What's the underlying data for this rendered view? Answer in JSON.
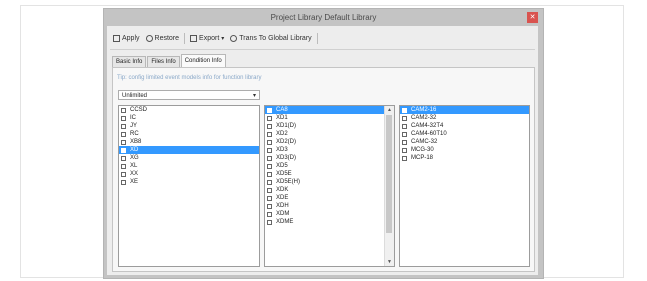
{
  "window": {
    "title": "Project Library Default Library",
    "close_glyph": "✕"
  },
  "toolbar": {
    "apply_label": "Apply",
    "restore_label": "Restore",
    "export_label": "Export",
    "export_caret": "▾",
    "trans_label": "Trans To Global Library",
    "icons": [
      "check-square-icon",
      "restore-icon",
      "export-icon",
      "transfer-icon"
    ]
  },
  "tabs": [
    {
      "label": "Basic Info",
      "active": false
    },
    {
      "label": "Files Info",
      "active": false
    },
    {
      "label": "Condition Info",
      "active": true
    }
  ],
  "tip_text": "Tip: config limited event models info for function library",
  "select": {
    "value": "Unlimited",
    "caret": "▾"
  },
  "list_left": {
    "items": [
      {
        "label": "CCSD",
        "selected": false
      },
      {
        "label": "IC",
        "selected": false
      },
      {
        "label": "JY",
        "selected": false
      },
      {
        "label": "RC",
        "selected": false
      },
      {
        "label": "XB8",
        "selected": false
      },
      {
        "label": "XD",
        "selected": true
      },
      {
        "label": "XG",
        "selected": false
      },
      {
        "label": "XL",
        "selected": false
      },
      {
        "label": "XX",
        "selected": false
      },
      {
        "label": "XE",
        "selected": false
      }
    ]
  },
  "list_middle": {
    "items": [
      {
        "label": "CA8",
        "selected": true
      },
      {
        "label": "XD1",
        "selected": false
      },
      {
        "label": "XD1(D)",
        "selected": false
      },
      {
        "label": "XD2",
        "selected": false
      },
      {
        "label": "XD2(D)",
        "selected": false
      },
      {
        "label": "XD3",
        "selected": false
      },
      {
        "label": "XD3(D)",
        "selected": false
      },
      {
        "label": "XD5",
        "selected": false
      },
      {
        "label": "XD5E",
        "selected": false
      },
      {
        "label": "XD5E(H)",
        "selected": false
      },
      {
        "label": "XDK",
        "selected": false
      },
      {
        "label": "XDE",
        "selected": false
      },
      {
        "label": "XDH",
        "selected": false
      },
      {
        "label": "XDM",
        "selected": false
      },
      {
        "label": "XDME",
        "selected": false
      }
    ],
    "scroll_up": "▲",
    "scroll_down": "▼"
  },
  "list_right": {
    "items": [
      {
        "label": "CAM2-16",
        "selected": true
      },
      {
        "label": "CAM2-32",
        "selected": false
      },
      {
        "label": "CAM4-32T4",
        "selected": false
      },
      {
        "label": "CAM4-60T10",
        "selected": false
      },
      {
        "label": "CAMC-32",
        "selected": false
      },
      {
        "label": "MCG-30",
        "selected": false
      },
      {
        "label": "MCP-18",
        "selected": false
      }
    ]
  },
  "colors": {
    "selection": "#3399ff",
    "close": "#d9534f",
    "tip": "#8aa8c8"
  }
}
